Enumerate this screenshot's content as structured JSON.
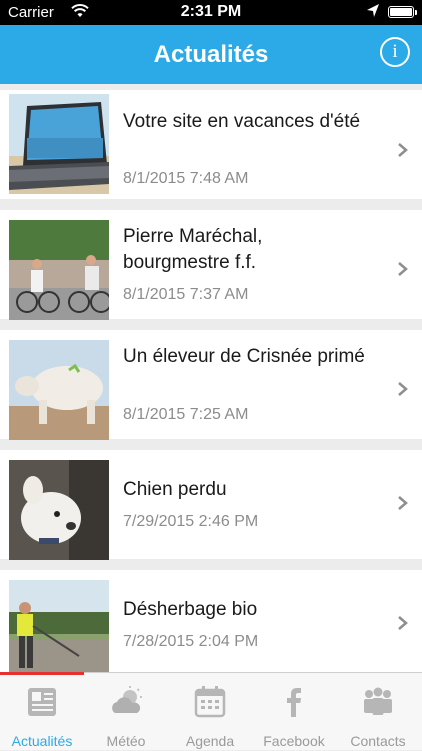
{
  "status_bar": {
    "carrier": "Carrier",
    "time": "2:31 PM"
  },
  "nav": {
    "title": "Actualités"
  },
  "news": [
    {
      "title": "Votre site en vacances d'été",
      "date": "8/1/2015 7:48 AM",
      "thumb": "laptop-on-beach-image"
    },
    {
      "title": "Pierre Maréchal, bourgmestre f.f.",
      "date": "8/1/2015 7:37 AM",
      "thumb": "cyclists-image"
    },
    {
      "title": "Un éleveur de Crisnée primé",
      "date": "8/1/2015 7:25 AM",
      "thumb": "cow-image"
    },
    {
      "title": "Chien perdu",
      "date": "7/29/2015 2:46 PM",
      "thumb": "dog-image"
    },
    {
      "title": "Désherbage bio",
      "date": "7/28/2015 2:04 PM",
      "thumb": "worker-weeding-image"
    }
  ],
  "tabs": [
    {
      "label": "Actualités",
      "icon": "newspaper-icon",
      "active": true
    },
    {
      "label": "Météo",
      "icon": "weather-cloud-icon",
      "active": false
    },
    {
      "label": "Agenda",
      "icon": "calendar-icon",
      "active": false
    },
    {
      "label": "Facebook",
      "icon": "facebook-icon",
      "active": false
    },
    {
      "label": "Contacts",
      "icon": "people-icon",
      "active": false
    }
  ],
  "colors": {
    "accent": "#2baae7",
    "active_tab_bar": "#e8312f",
    "date_text": "#8c8c8c"
  }
}
